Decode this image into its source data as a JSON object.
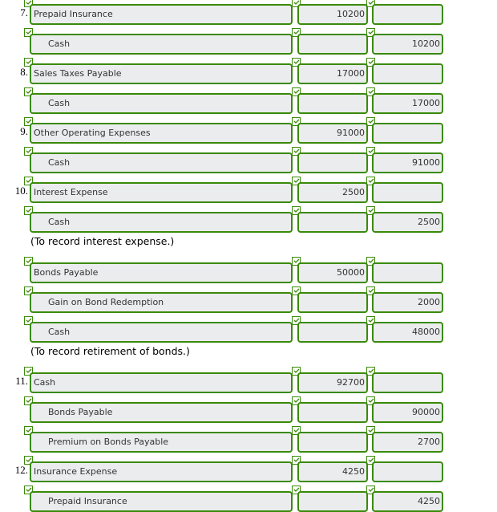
{
  "entries": [
    {
      "number": "7.",
      "lines": [
        {
          "account": "Prepaid Insurance",
          "debit": "10200",
          "credit": "",
          "indent": false
        },
        {
          "account": "Cash",
          "debit": "",
          "credit": "10200",
          "indent": true
        }
      ]
    },
    {
      "number": "8.",
      "lines": [
        {
          "account": "Sales Taxes Payable",
          "debit": "17000",
          "credit": "",
          "indent": false
        },
        {
          "account": "Cash",
          "debit": "",
          "credit": "17000",
          "indent": true
        }
      ]
    },
    {
      "number": "9.",
      "lines": [
        {
          "account": "Other Operating Expenses",
          "debit": "91000",
          "credit": "",
          "indent": false
        },
        {
          "account": "Cash",
          "debit": "",
          "credit": "91000",
          "indent": true
        }
      ]
    },
    {
      "number": "10.",
      "lines": [
        {
          "account": "Interest Expense",
          "debit": "2500",
          "credit": "",
          "indent": false
        },
        {
          "account": "Cash",
          "debit": "",
          "credit": "2500",
          "indent": true
        }
      ],
      "memo": "(To record interest expense.)"
    },
    {
      "number": "",
      "lines": [
        {
          "account": "Bonds Payable",
          "debit": "50000",
          "credit": "",
          "indent": false
        },
        {
          "account": "Gain on Bond Redemption",
          "debit": "",
          "credit": "2000",
          "indent": true
        },
        {
          "account": "Cash",
          "debit": "",
          "credit": "48000",
          "indent": true
        }
      ],
      "memo": "(To record retirement of bonds.)"
    },
    {
      "number": "11.",
      "lines": [
        {
          "account": "Cash",
          "debit": "92700",
          "credit": "",
          "indent": false
        },
        {
          "account": "Bonds Payable",
          "debit": "",
          "credit": "90000",
          "indent": true
        },
        {
          "account": "Premium on Bonds Payable",
          "debit": "",
          "credit": "2700",
          "indent": true
        }
      ]
    },
    {
      "number": "12.",
      "lines": [
        {
          "account": "Insurance Expense",
          "debit": "4250",
          "credit": "",
          "indent": false
        },
        {
          "account": "Prepaid Insurance",
          "debit": "",
          "credit": "4250",
          "indent": true
        }
      ]
    }
  ],
  "check_icon": "checkmark-icon",
  "colors": {
    "border": "#3a8a0a",
    "field_bg": "#ebecee"
  }
}
